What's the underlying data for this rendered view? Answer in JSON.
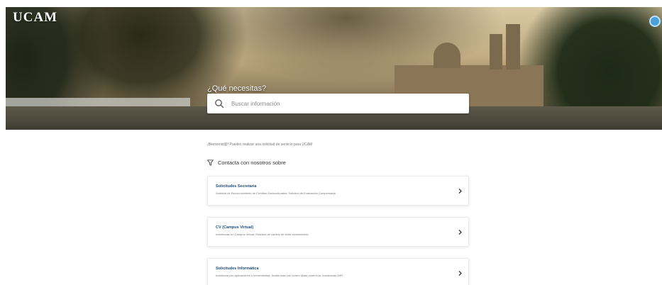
{
  "header": {
    "brand": "UCAM",
    "hero_heading": "¿Qué necesitas?",
    "search": {
      "placeholder": "Buscar información",
      "value": ""
    },
    "corner_icon": "help-bubble-icon"
  },
  "main": {
    "welcome_text": "¡Bienvenid@! Puedes realizar una solicitud de servicio para UCAM",
    "contact_heading": "Contacta con nosotros sobre",
    "cards": [
      {
        "title": "Solicitudes Secretaría",
        "description": "Solicitud de Reconocimiento de Créditos Socioculturales; Solicitud de Evaluación Compensada"
      },
      {
        "title": "CV (Campus Virtual)",
        "description": "Incidencias en Campus Virtual; Solicitud de cambio de sede examinadora"
      },
      {
        "title": "Solicitudes Informática",
        "description": "Incidencia con aplicaciones o herramientas; Incidencias con correo @alu.ucam.edu; Incidencias WiFi"
      }
    ]
  },
  "colors": {
    "card_title": "#1f4c7a",
    "accent": "#4aa0d8"
  }
}
